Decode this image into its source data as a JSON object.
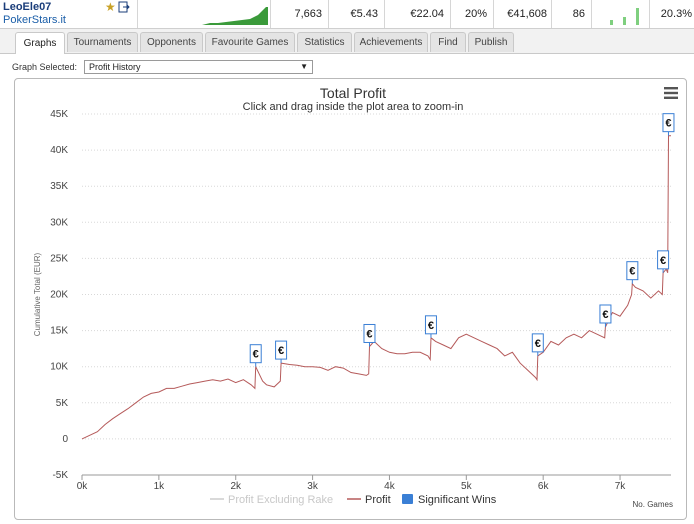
{
  "player": {
    "name": "LeoEle07",
    "site": "PokerStars.it"
  },
  "stats": {
    "games": "7,663",
    "avg_profit": "€5.43",
    "avg_stake": "€22.04",
    "roi": "20%",
    "total_profit": "€41,608",
    "ability": "86",
    "itm": "20.3%",
    "sparkline_color": "#3a9a3a",
    "mini_bars": [
      0.25,
      0.45,
      0.95
    ]
  },
  "tabs": [
    "Graphs",
    "Tournaments",
    "Opponents",
    "Favourite Games",
    "Statistics",
    "Achievements",
    "Find",
    "Publish"
  ],
  "active_tab": 0,
  "graph_selector": {
    "label": "Graph Selected:",
    "value": "Profit History"
  },
  "chart_data": {
    "type": "line",
    "title": "Total Profit",
    "subtitle": "Click and drag inside the plot area to zoom-in",
    "xlabel": "No. Games",
    "ylabel": "Cumulative Total (EUR)",
    "xlim": [
      0,
      7663
    ],
    "ylim": [
      -5000,
      45000
    ],
    "x_ticks": [
      0,
      1000,
      2000,
      3000,
      4000,
      5000,
      6000,
      7000
    ],
    "x_tick_labels": [
      "0k",
      "1k",
      "2k",
      "3k",
      "4k",
      "5k",
      "6k",
      "7k"
    ],
    "y_ticks": [
      -5000,
      0,
      5000,
      10000,
      15000,
      20000,
      25000,
      30000,
      35000,
      40000,
      45000
    ],
    "y_tick_labels": [
      "-5K",
      "0",
      "5K",
      "10K",
      "15K",
      "20K",
      "25K",
      "30K",
      "35K",
      "40K",
      "45K"
    ],
    "grid": true,
    "legend_placement": "bottom",
    "legend": [
      {
        "name": "Profit Excluding Rake",
        "color": "#cccccc",
        "hidden": true
      },
      {
        "name": "Profit",
        "color": "#b55a5a"
      },
      {
        "name": "Significant Wins",
        "color": "#3a7fd5"
      }
    ],
    "series": [
      {
        "name": "Profit",
        "color": "#b55a5a",
        "x": [
          0,
          100,
          200,
          300,
          400,
          500,
          600,
          700,
          800,
          900,
          1000,
          1100,
          1200,
          1300,
          1400,
          1500,
          1600,
          1700,
          1800,
          1900,
          2000,
          2100,
          2200,
          2250,
          2260,
          2350,
          2400,
          2500,
          2580,
          2590,
          2700,
          2800,
          2900,
          3000,
          3100,
          3200,
          3300,
          3400,
          3500,
          3600,
          3700,
          3730,
          3740,
          3800,
          3900,
          4000,
          4100,
          4200,
          4300,
          4400,
          4500,
          4530,
          4540,
          4600,
          4700,
          4800,
          4900,
          5000,
          5100,
          5200,
          5300,
          5400,
          5500,
          5600,
          5700,
          5800,
          5900,
          5920,
          5930,
          6000,
          6100,
          6200,
          6300,
          6400,
          6500,
          6600,
          6700,
          6800,
          6810,
          6900,
          7000,
          7100,
          7150,
          7160,
          7200,
          7300,
          7400,
          7500,
          7550,
          7560,
          7600,
          7620,
          7630,
          7663
        ],
        "values": [
          0,
          500,
          1000,
          2000,
          2800,
          3500,
          4200,
          5000,
          5800,
          6300,
          6500,
          7000,
          7000,
          7300,
          7600,
          7800,
          8000,
          8200,
          8000,
          8300,
          7800,
          8200,
          7500,
          7000,
          10000,
          8000,
          7500,
          7200,
          8000,
          10500,
          10300,
          10200,
          10000,
          10000,
          9900,
          9500,
          10000,
          9800,
          9200,
          9000,
          8800,
          9000,
          12800,
          13500,
          12500,
          12000,
          11800,
          11800,
          12000,
          12000,
          11500,
          11000,
          14000,
          13500,
          13000,
          12500,
          14000,
          14500,
          14000,
          13500,
          13000,
          12500,
          11500,
          12000,
          10500,
          9500,
          8500,
          8200,
          11500,
          12000,
          13500,
          13000,
          14000,
          14500,
          14000,
          15000,
          14500,
          14000,
          15500,
          17500,
          17000,
          18500,
          20000,
          21500,
          21000,
          20500,
          19500,
          20500,
          20000,
          23000,
          23500,
          23000,
          42000,
          42000
        ]
      }
    ],
    "significant_wins": [
      {
        "x": 2260,
        "y": 10000,
        "label": "€"
      },
      {
        "x": 2590,
        "y": 10500,
        "label": "€"
      },
      {
        "x": 3740,
        "y": 12800,
        "label": "€"
      },
      {
        "x": 4540,
        "y": 14000,
        "label": "€"
      },
      {
        "x": 5930,
        "y": 11500,
        "label": "€"
      },
      {
        "x": 6810,
        "y": 15500,
        "label": "€"
      },
      {
        "x": 7160,
        "y": 21500,
        "label": "€"
      },
      {
        "x": 7560,
        "y": 23000,
        "label": "€"
      },
      {
        "x": 7630,
        "y": 42000,
        "label": "€"
      }
    ]
  }
}
